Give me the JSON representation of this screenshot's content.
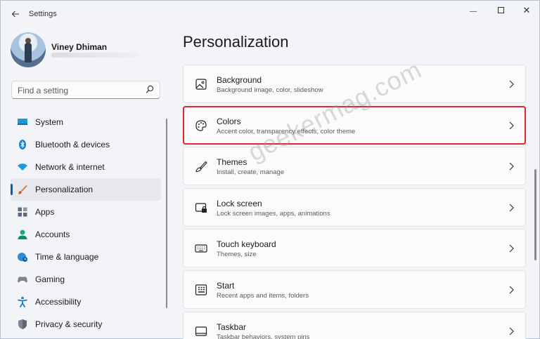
{
  "window": {
    "title": "Settings",
    "back_icon": "back-arrow-icon",
    "minimize_glyph": "—",
    "close_glyph": "✕"
  },
  "profile": {
    "name": "Viney Dhiman"
  },
  "search": {
    "placeholder": "Find a setting",
    "value": ""
  },
  "sidebar": {
    "items": [
      {
        "label": "System",
        "icon": "system-icon",
        "active": false
      },
      {
        "label": "Bluetooth & devices",
        "icon": "bluetooth-icon",
        "active": false
      },
      {
        "label": "Network & internet",
        "icon": "wifi-icon",
        "active": false
      },
      {
        "label": "Personalization",
        "icon": "brush-icon",
        "active": true
      },
      {
        "label": "Apps",
        "icon": "apps-icon",
        "active": false
      },
      {
        "label": "Accounts",
        "icon": "accounts-icon",
        "active": false
      },
      {
        "label": "Time & language",
        "icon": "globe-clock-icon",
        "active": false
      },
      {
        "label": "Gaming",
        "icon": "gamepad-icon",
        "active": false
      },
      {
        "label": "Accessibility",
        "icon": "accessibility-icon",
        "active": false
      },
      {
        "label": "Privacy & security",
        "icon": "shield-icon",
        "active": false
      }
    ]
  },
  "main": {
    "title": "Personalization",
    "cards": [
      {
        "title": "Background",
        "subtitle": "Background image, color, slideshow",
        "icon": "image-icon"
      },
      {
        "title": "Colors",
        "subtitle": "Accent color, transparency effects, color theme",
        "icon": "palette-icon",
        "highlighted": true
      },
      {
        "title": "Themes",
        "subtitle": "Install, create, manage",
        "icon": "paintbrush-icon"
      },
      {
        "title": "Lock screen",
        "subtitle": "Lock screen images, apps, animations",
        "icon": "lock-screen-icon"
      },
      {
        "title": "Touch keyboard",
        "subtitle": "Themes, size",
        "icon": "keyboard-icon"
      },
      {
        "title": "Start",
        "subtitle": "Recent apps and items, folders",
        "icon": "start-icon"
      },
      {
        "title": "Taskbar",
        "subtitle": "Taskbar behaviors, system pins",
        "icon": "taskbar-icon"
      }
    ]
  },
  "watermark": "geekermag.com",
  "colors": {
    "accent": "#005fb8",
    "highlight_border": "#e3262f"
  }
}
